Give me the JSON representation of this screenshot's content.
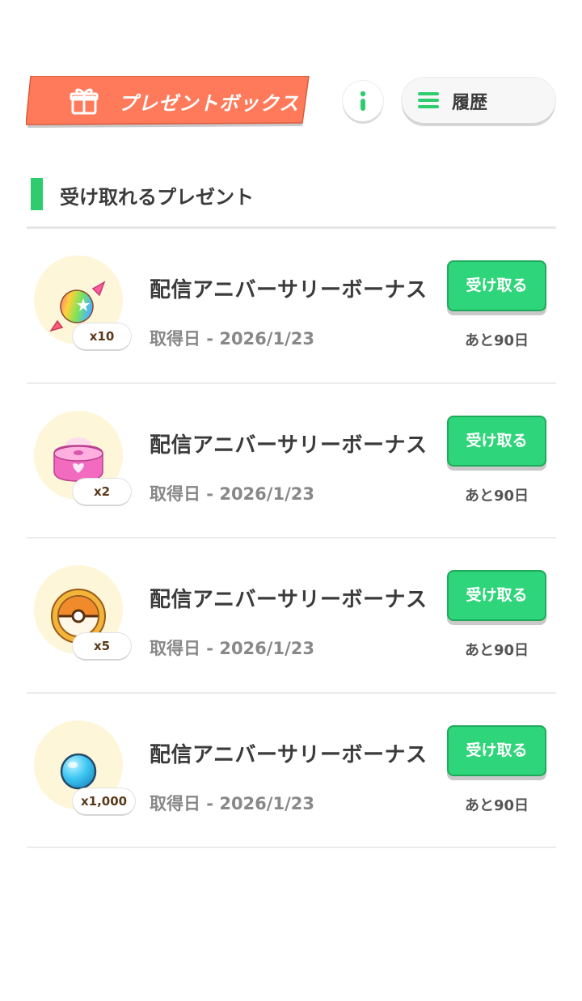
{
  "header": {
    "title": "プレゼントボックス",
    "info_icon": "info-icon",
    "history_label": "履歴"
  },
  "section": {
    "title": "受け取れるプレゼント",
    "accent_color": "#2ecc6e"
  },
  "colors": {
    "title_tag": "#ff7a5a",
    "claim_button": "#2fd57a"
  },
  "presents": [
    {
      "icon": "rainbow-candy-icon",
      "quantity": "x10",
      "name": "配信アニバーサリーボーナス",
      "date": "取得日 - 2026/1/23",
      "claim_label": "受け取る",
      "remaining": "あと90日"
    },
    {
      "icon": "pink-cushion-icon",
      "quantity": "x2",
      "name": "配信アニバーサリーボーナス",
      "date": "取得日 - 2026/1/23",
      "claim_label": "受け取る",
      "remaining": "あと90日"
    },
    {
      "icon": "ball-badge-icon",
      "quantity": "x5",
      "name": "配信アニバーサリーボーナス",
      "date": "取得日 - 2026/1/23",
      "claim_label": "受け取る",
      "remaining": "あと90日"
    },
    {
      "icon": "blue-gem-icon",
      "quantity": "x1,000",
      "name": "配信アニバーサリーボーナス",
      "date": "取得日 - 2026/1/23",
      "claim_label": "受け取る",
      "remaining": "あと90日"
    }
  ]
}
